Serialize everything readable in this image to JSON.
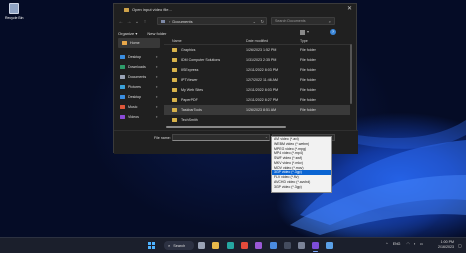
{
  "desktop": {
    "recycle_bin_label": "Recycle Bin"
  },
  "dialog": {
    "title": "Open input video file...",
    "close_glyph": "✕",
    "nav": {
      "back": "←",
      "forward": "→",
      "up_dropdown": "⌄",
      "up": "↑"
    },
    "address": {
      "separator": "›",
      "path": "Documents",
      "dropdown": "⌄",
      "refresh": "↻"
    },
    "search": {
      "placeholder": "Search Documents",
      "icon": "⌕"
    },
    "commands": {
      "organize": "Organize ▾",
      "new_folder": "New folder"
    },
    "view_dropdown": "▾",
    "help": "?",
    "sidebar": [
      {
        "label": "Home",
        "icon": "home-icon",
        "color": "#e9a84a",
        "pinned": false,
        "active": true
      },
      {
        "separator": true
      },
      {
        "label": "Desktop",
        "icon": "desktop-icon",
        "color": "#3a8de0",
        "pinned": true
      },
      {
        "label": "Downloads",
        "icon": "downloads-icon",
        "color": "#2e9c6a",
        "pinned": true
      },
      {
        "label": "Documents",
        "icon": "documents-icon",
        "color": "#9aa3b5",
        "pinned": true
      },
      {
        "label": "Pictures",
        "icon": "pictures-icon",
        "color": "#3aa1d8",
        "pinned": true
      },
      {
        "label": "Desktop",
        "icon": "desktop-icon",
        "color": "#3a8de0",
        "pinned": true
      },
      {
        "label": "Music",
        "icon": "music-icon",
        "color": "#e0583a",
        "pinned": true
      },
      {
        "label": "Videos",
        "icon": "videos-icon",
        "color": "#8a4ad8",
        "pinned": true
      }
    ],
    "columns": {
      "name": "Name",
      "date": "Date modified",
      "type": "Type"
    },
    "files": [
      {
        "name": "Graphics",
        "date": "1/26/2023 1:52 PM",
        "type": "File folder",
        "highlight": false
      },
      {
        "name": "IDM Computer Solutions",
        "date": "1/31/2023 2:35 PM",
        "type": "File folder",
        "highlight": false
      },
      {
        "name": "IISExpress",
        "date": "12/11/2022 8:03 PM",
        "type": "File folder",
        "highlight": false
      },
      {
        "name": "IPTViewer",
        "date": "12/7/2022 11:46 AM",
        "type": "File folder",
        "highlight": false
      },
      {
        "name": "My Web Sites",
        "date": "12/11/2022 8:03 PM",
        "type": "File folder",
        "highlight": false
      },
      {
        "name": "PaperPDF",
        "date": "12/11/2022 8:27 PM",
        "type": "File folder",
        "highlight": false
      },
      {
        "name": "TaskbarTools",
        "date": "1/26/2023 8:51 AM",
        "type": "File folder",
        "highlight": true
      },
      {
        "name": "TechSmith",
        "date": "",
        "type": "",
        "highlight": false
      }
    ],
    "footer": {
      "file_name_label": "File name:",
      "file_name_value": "",
      "file_name_dropdown": "⌄",
      "file_type_selected": "AVI video (*.avi)"
    },
    "type_options": [
      "AVI video (*.avi)",
      "WEBM video (*.webm)",
      "MPEG video (*.mpg)",
      "MP4 video (*.mp4)",
      "SWF video (*.swf)",
      "MKV video (*.mkv)",
      "MOV video (*.mov)",
      "3GP video (*.3gp)",
      "FLV video (*.flv)",
      "AVCHD video (*.avchd)",
      "3GP video (*.3gp)"
    ],
    "type_options_selected_index": 7
  },
  "taskbar": {
    "search_label": "Search",
    "search_icon": "⌕",
    "tray": {
      "chevron": "^",
      "language": "ENG",
      "wifi": "◠",
      "volume": "◗",
      "battery": "▭"
    },
    "time": "1:00 PM",
    "date": "2/16/2023",
    "notification": "▢",
    "apps": [
      {
        "name": "task-view-icon",
        "color": "#9aa3b5"
      },
      {
        "name": "file-explorer-icon",
        "color": "#e7b84a"
      },
      {
        "name": "edge-icon",
        "color": "#25a7a1"
      },
      {
        "name": "chrome-icon",
        "color": "#e44b3b"
      },
      {
        "name": "visual-studio-icon",
        "color": "#9b59d6"
      },
      {
        "name": "store-icon",
        "color": "#4a8be0"
      },
      {
        "name": "terminal-icon",
        "color": "#444c5e"
      },
      {
        "name": "settings-icon",
        "color": "#7b8397"
      },
      {
        "name": "visual-studio-2-icon",
        "color": "#7c4dd8"
      },
      {
        "name": "video-app-icon",
        "color": "#5aa0e8"
      }
    ]
  }
}
